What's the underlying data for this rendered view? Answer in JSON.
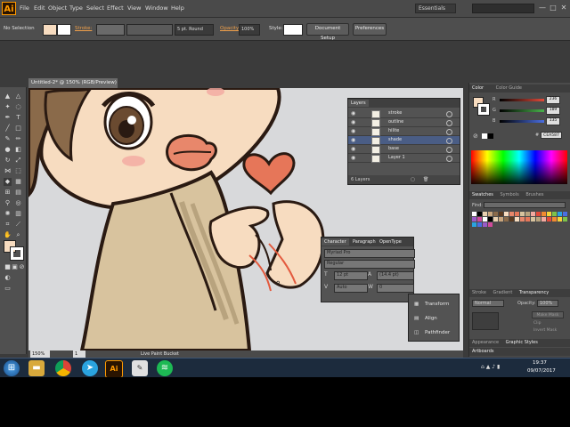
{
  "app": {
    "logo": "Ai",
    "menus": [
      "File",
      "Edit",
      "Object",
      "Type",
      "Select",
      "Effect",
      "View",
      "Window",
      "Help"
    ],
    "workspace": "Essentials",
    "window_controls": [
      "—",
      "□",
      "✕"
    ]
  },
  "controlbar": {
    "selection": "No Selection",
    "stroke_label": "Stroke:",
    "brush": "5 pt. Round",
    "opacity_label": "Opacity:",
    "opacity_value": "100%",
    "style_label": "Style:",
    "document_setup": "Document Setup",
    "preferences": "Preferences"
  },
  "document": {
    "tab_title": "Untitled-2* @ 150% (RGB/Preview)",
    "zoom": "150%",
    "page": "1",
    "status_tool": "Live Paint Bucket"
  },
  "layers_panel": {
    "tab": "Layers",
    "rows": [
      {
        "name": "stroke"
      },
      {
        "name": "outline"
      },
      {
        "name": "hilite"
      },
      {
        "name": "shade"
      },
      {
        "name": "base"
      },
      {
        "name": "Layer 1"
      }
    ],
    "footer": "6 Layers"
  },
  "character_panel": {
    "tabs": [
      "Character",
      "Paragraph",
      "OpenType"
    ],
    "font_family": "Myriad Pro",
    "font_style": "Regular",
    "font_size": "12 pt",
    "leading": "(14.4 pt)",
    "kerning": "Auto",
    "tracking": "0"
  },
  "transform_panel": {
    "items": [
      "Transform",
      "Align",
      "Pathfinder"
    ]
  },
  "color_panel": {
    "tabs": [
      "Color",
      "Color Guide"
    ],
    "channels": [
      {
        "label": "R",
        "value": "236",
        "color": "#e24a3a"
      },
      {
        "label": "G",
        "value": "189",
        "color": "#49b24b"
      },
      {
        "label": "B",
        "value": "135",
        "color": "#4a6ee2"
      }
    ],
    "hex": "CEA587"
  },
  "swatches_panel": {
    "tabs": [
      "Swatches",
      "Symbols",
      "Brushes"
    ],
    "search_label": "Find:"
  },
  "stroke_panel": {
    "tabs": [
      "Stroke",
      "Gradient",
      "Transparency"
    ],
    "blend_mode": "Normal",
    "opacity_label": "Opacity:",
    "opacity_value": "100%",
    "options": [
      "Make Mask",
      "Clip",
      "Invert Mask"
    ]
  },
  "bottom_tabs": [
    "Appearance",
    "Graphic Styles"
  ],
  "artboards_tab": "Artboards",
  "taskbar": {
    "time": "19:37",
    "date": "09/07/2017",
    "ai_label": "Ai"
  },
  "colors": {
    "skin": "#f7dcc0",
    "outline": "#2a1a12",
    "hair": "#8a6a4a",
    "robe": "#d8c39e",
    "heart": "#e67659",
    "lips": "#e8876b",
    "selection": "#e35a3e"
  }
}
